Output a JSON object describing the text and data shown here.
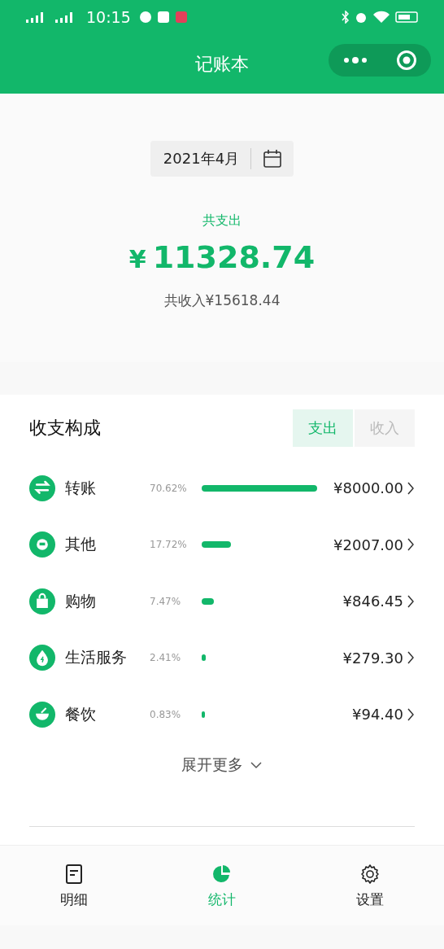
{
  "status_bar": {
    "time": "10:15"
  },
  "header": {
    "title": "记账本"
  },
  "summary": {
    "month": "2021年4月",
    "expense_label": "共支出",
    "currency": "¥",
    "expense_total": "11328.74",
    "income": "共收入¥15618.44"
  },
  "composition": {
    "title": "收支构成",
    "toggle": [
      {
        "label": "支出",
        "selected": true
      },
      {
        "label": "收入",
        "selected": false
      }
    ],
    "categories": [
      {
        "name": "转账",
        "percent": "70.62%",
        "amount": "¥8000.00"
      },
      {
        "name": "其他",
        "percent": "17.72%",
        "amount": "¥2007.00"
      },
      {
        "name": "购物",
        "percent": "7.47%",
        "amount": "¥846.45"
      },
      {
        "name": "生活服务",
        "percent": "2.41%",
        "amount": "¥279.30"
      },
      {
        "name": "餐饮",
        "percent": "0.83%",
        "amount": "¥94.40"
      }
    ],
    "more": "展开更多"
  },
  "tabs": [
    {
      "label": "明细",
      "selected": false
    },
    {
      "label": "统计",
      "selected": true
    },
    {
      "label": "设置",
      "selected": false
    }
  ]
}
